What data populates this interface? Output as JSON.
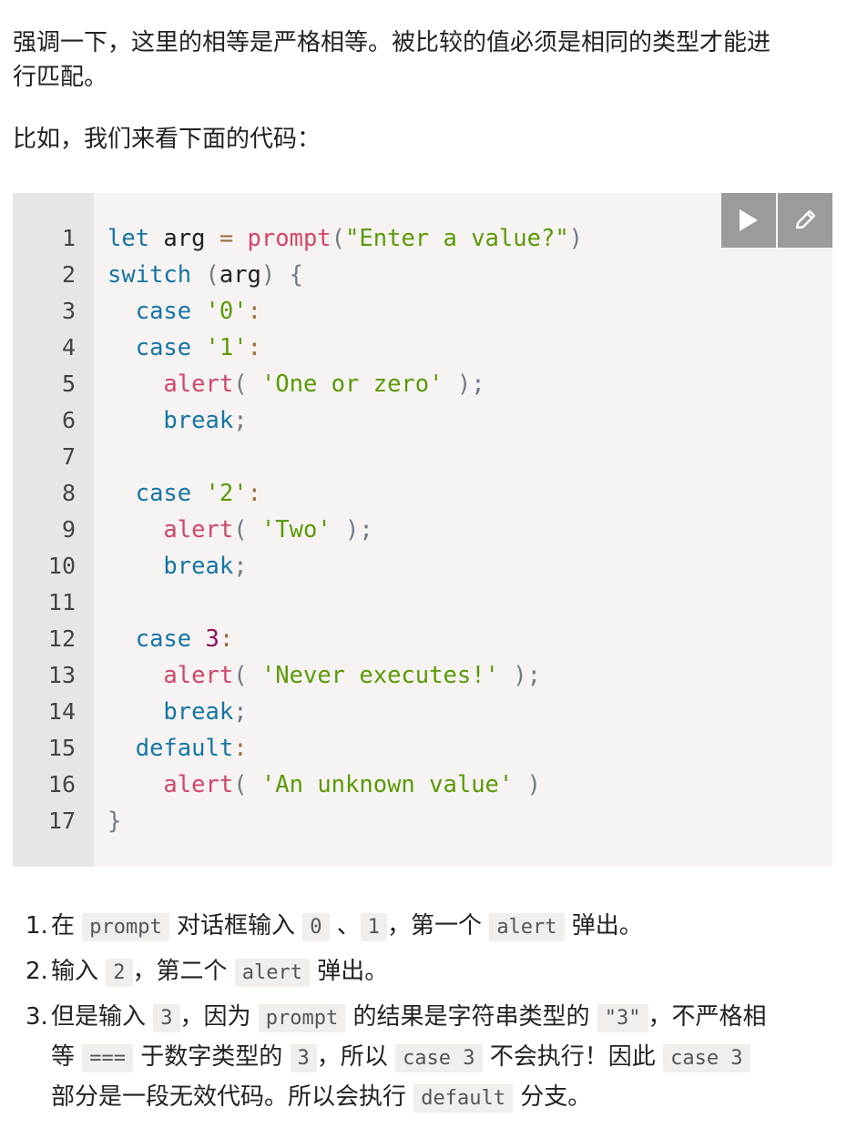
{
  "intro": {
    "line1": "强调一下，这里的相等是严格相等。被比较的值必须是相同的类型才能进",
    "line2": "行匹配。",
    "lead": "比如，我们来看下面的代码："
  },
  "toolbar": {
    "run_icon": "play-icon",
    "edit_icon": "pencil-icon"
  },
  "code": {
    "line_numbers": [
      "1",
      "2",
      "3",
      "4",
      "5",
      "6",
      "7",
      "8",
      "9",
      "10",
      "11",
      "12",
      "13",
      "14",
      "15",
      "16",
      "17"
    ],
    "lines": [
      [
        [
          "kw",
          "let"
        ],
        [
          "tx",
          " arg "
        ],
        [
          "op",
          "="
        ],
        [
          "tx",
          " "
        ],
        [
          "fn",
          "prompt"
        ],
        [
          "pn",
          "("
        ],
        [
          "st",
          "\"Enter a value?\""
        ],
        [
          "pn",
          ")"
        ]
      ],
      [
        [
          "kw",
          "switch"
        ],
        [
          "tx",
          " "
        ],
        [
          "pn",
          "("
        ],
        [
          "tx",
          "arg"
        ],
        [
          "pn",
          ")"
        ],
        [
          "tx",
          " "
        ],
        [
          "pn",
          "{"
        ]
      ],
      [
        [
          "tx",
          "  "
        ],
        [
          "kw",
          "case"
        ],
        [
          "tx",
          " "
        ],
        [
          "st",
          "'0'"
        ],
        [
          "op",
          ":"
        ]
      ],
      [
        [
          "tx",
          "  "
        ],
        [
          "kw",
          "case"
        ],
        [
          "tx",
          " "
        ],
        [
          "st",
          "'1'"
        ],
        [
          "op",
          ":"
        ]
      ],
      [
        [
          "tx",
          "    "
        ],
        [
          "fn",
          "alert"
        ],
        [
          "pn",
          "("
        ],
        [
          "tx",
          " "
        ],
        [
          "st",
          "'One or zero'"
        ],
        [
          "tx",
          " "
        ],
        [
          "pn",
          ")"
        ],
        [
          "pn",
          ";"
        ]
      ],
      [
        [
          "tx",
          "    "
        ],
        [
          "kw",
          "break"
        ],
        [
          "pn",
          ";"
        ]
      ],
      [],
      [
        [
          "tx",
          "  "
        ],
        [
          "kw",
          "case"
        ],
        [
          "tx",
          " "
        ],
        [
          "st",
          "'2'"
        ],
        [
          "op",
          ":"
        ]
      ],
      [
        [
          "tx",
          "    "
        ],
        [
          "fn",
          "alert"
        ],
        [
          "pn",
          "("
        ],
        [
          "tx",
          " "
        ],
        [
          "st",
          "'Two'"
        ],
        [
          "tx",
          " "
        ],
        [
          "pn",
          ")"
        ],
        [
          "pn",
          ";"
        ]
      ],
      [
        [
          "tx",
          "    "
        ],
        [
          "kw",
          "break"
        ],
        [
          "pn",
          ";"
        ]
      ],
      [],
      [
        [
          "tx",
          "  "
        ],
        [
          "kw",
          "case"
        ],
        [
          "tx",
          " "
        ],
        [
          "nm",
          "3"
        ],
        [
          "op",
          ":"
        ]
      ],
      [
        [
          "tx",
          "    "
        ],
        [
          "fn",
          "alert"
        ],
        [
          "pn",
          "("
        ],
        [
          "tx",
          " "
        ],
        [
          "st",
          "'Never executes!'"
        ],
        [
          "tx",
          " "
        ],
        [
          "pn",
          ")"
        ],
        [
          "pn",
          ";"
        ]
      ],
      [
        [
          "tx",
          "    "
        ],
        [
          "kw",
          "break"
        ],
        [
          "pn",
          ";"
        ]
      ],
      [
        [
          "tx",
          "  "
        ],
        [
          "kw",
          "default"
        ],
        [
          "op",
          ":"
        ]
      ],
      [
        [
          "tx",
          "    "
        ],
        [
          "fn",
          "alert"
        ],
        [
          "pn",
          "("
        ],
        [
          "tx",
          " "
        ],
        [
          "st",
          "'An unknown value'"
        ],
        [
          "tx",
          " "
        ],
        [
          "pn",
          ")"
        ]
      ],
      [
        [
          "pn",
          "}"
        ]
      ]
    ]
  },
  "list": {
    "item1": {
      "num": "1.",
      "t1": "在 ",
      "c1": "prompt",
      "t2": " 对话框输入 ",
      "c2": "0",
      "t3": " 、",
      "c3": "1",
      "t4": "，第一个 ",
      "c4": "alert",
      "t5": " 弹出。"
    },
    "item2": {
      "num": "2.",
      "t1": "输入 ",
      "c1": "2",
      "t2": "，第二个 ",
      "c2": "alert",
      "t3": " 弹出。"
    },
    "item3": {
      "num": "3.",
      "t1": "但是输入 ",
      "c1": "3",
      "t2": "，因为 ",
      "c2": "prompt",
      "t3": " 的结果是字符串类型的 ",
      "c3": "\"3\"",
      "t4": "，不严格相",
      "t5": "等 ",
      "c4": "===",
      "t6": " 于数字类型的 ",
      "c5": "3",
      "t7": "，所以 ",
      "c6": "case 3",
      "t8": " 不会执行！因此 ",
      "c7": "case 3",
      "t9": "部分是一段无效代码。所以会执行 ",
      "c8": "default",
      "t10": " 分支。"
    }
  }
}
